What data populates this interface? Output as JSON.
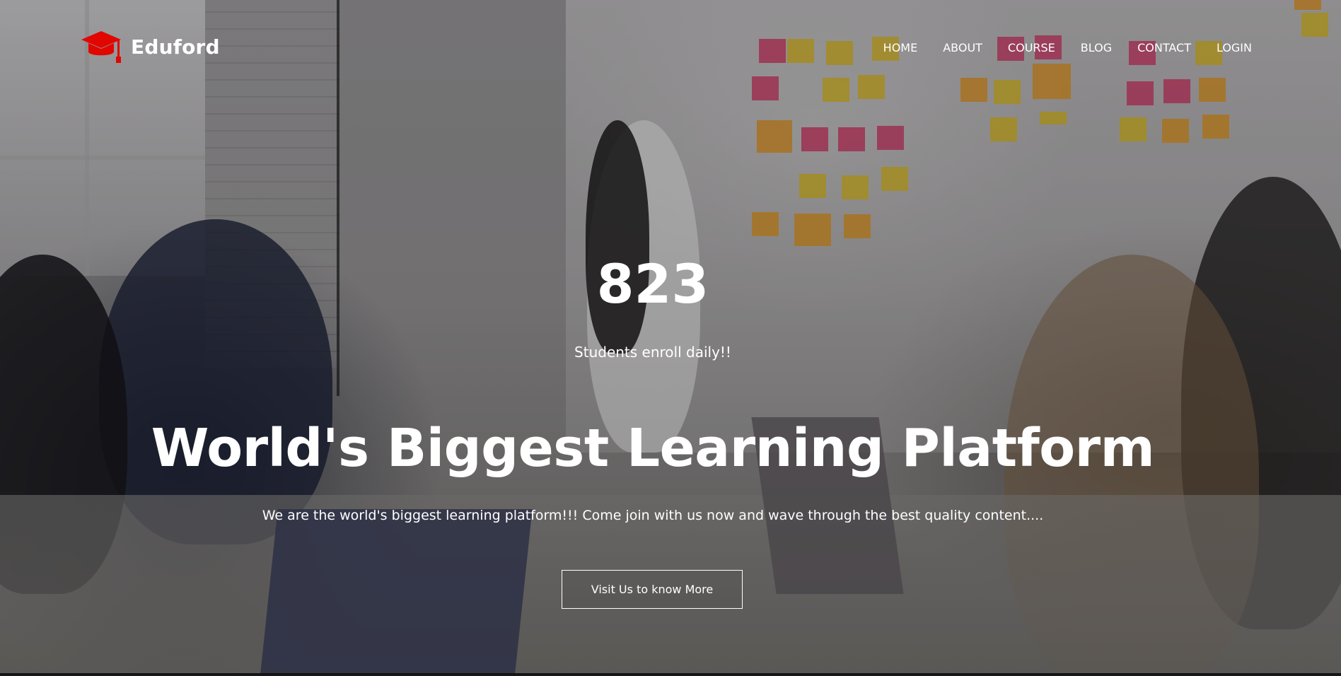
{
  "brand": {
    "name": "Eduford",
    "icon": "graduation-cap-icon",
    "icon_color": "#e10600"
  },
  "nav": {
    "items": [
      {
        "label": "HOME"
      },
      {
        "label": "ABOUT"
      },
      {
        "label": "COURSE"
      },
      {
        "label": "BLOG"
      },
      {
        "label": "CONTACT"
      },
      {
        "label": "LOGIN"
      }
    ]
  },
  "hero": {
    "counter": "823",
    "counter_caption": "Students enroll daily!!",
    "headline": "World's Biggest Learning Platform",
    "subtitle": "We are the world's biggest learning platform!!! Come join with us now and wave through the best quality content....",
    "cta_label": "Visit Us to know More",
    "text_color": "#ffffff"
  }
}
